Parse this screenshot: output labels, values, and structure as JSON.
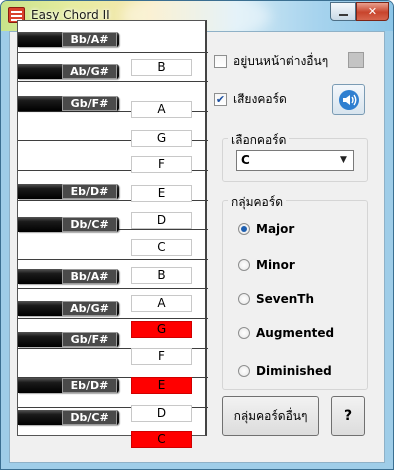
{
  "window": {
    "title": "Easy Chord II",
    "icon": "app-icon",
    "controls": {
      "minimize": "minimize-icon",
      "close": "✕"
    }
  },
  "piano": {
    "black_keys": [
      "Bb/A#",
      "Ab/G#",
      "Gb/F#",
      "Eb/D#",
      "Db/C#",
      "Bb/A#",
      "Ab/G#",
      "Gb/F#",
      "Eb/D#",
      "Db/C#"
    ],
    "white_notes": [
      {
        "name": "B",
        "highlighted": false
      },
      {
        "name": "A",
        "highlighted": false
      },
      {
        "name": "G",
        "highlighted": false
      },
      {
        "name": "F",
        "highlighted": false
      },
      {
        "name": "E",
        "highlighted": false
      },
      {
        "name": "D",
        "highlighted": false
      },
      {
        "name": "C",
        "highlighted": false
      },
      {
        "name": "B",
        "highlighted": false
      },
      {
        "name": "A",
        "highlighted": false
      },
      {
        "name": "G",
        "highlighted": true
      },
      {
        "name": "F",
        "highlighted": false
      },
      {
        "name": "E",
        "highlighted": true
      },
      {
        "name": "D",
        "highlighted": false
      },
      {
        "name": "C",
        "highlighted": true
      }
    ],
    "highlight_color": "#ff0000"
  },
  "options": {
    "always_on_top": {
      "label": "อยู่บนหน้าต่างอื่นๆ",
      "checked": false
    },
    "chord_sound": {
      "label": "เสียงคอร์ด",
      "checked": true
    },
    "speaker_icon": "speaker-icon"
  },
  "chord_select": {
    "title": "เลือกคอร์ด",
    "value": "C"
  },
  "chord_group": {
    "title": "กลุ่มคอร์ด",
    "options": [
      {
        "label": "Major",
        "selected": true
      },
      {
        "label": "Minor",
        "selected": false
      },
      {
        "label": "SevenTh",
        "selected": false
      },
      {
        "label": "Augmented",
        "selected": false
      },
      {
        "label": "Diminished",
        "selected": false
      }
    ]
  },
  "buttons": {
    "other_groups": "กลุ่มคอร์ดอื่นๆ",
    "help": "?"
  }
}
